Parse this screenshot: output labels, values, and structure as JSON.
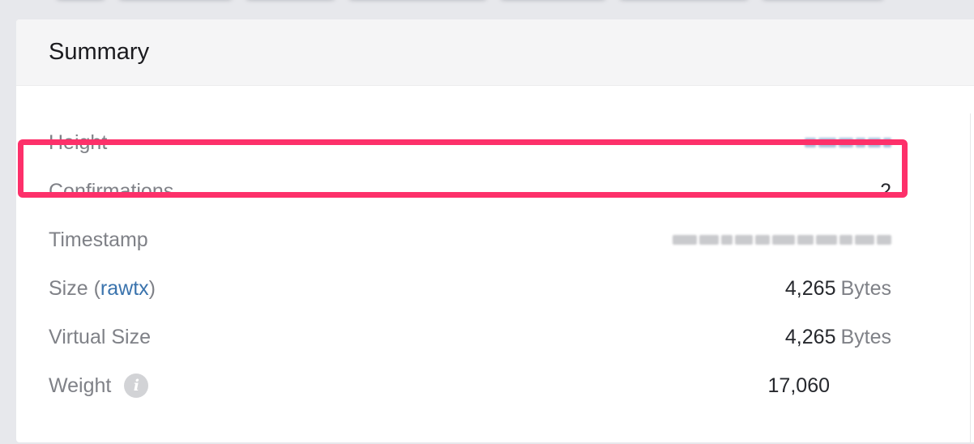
{
  "summary": {
    "title": "Summary",
    "rows": {
      "height": {
        "label": "Height"
      },
      "confirmations": {
        "label": "Confirmations",
        "value": "2"
      },
      "timestamp": {
        "label": "Timestamp"
      },
      "size": {
        "label": "Size (",
        "link": "rawtx",
        "close": ")",
        "value": "4,265",
        "unit": "Bytes"
      },
      "virtual_size": {
        "label": "Virtual Size",
        "value": "4,265",
        "unit": "Bytes"
      },
      "weight": {
        "label": "Weight",
        "value": "17,060",
        "icon": "info-icon"
      }
    }
  },
  "colors": {
    "highlight": "#fd306a",
    "link": "#3a73ad",
    "label": "#7f8187",
    "value": "#26282d"
  }
}
